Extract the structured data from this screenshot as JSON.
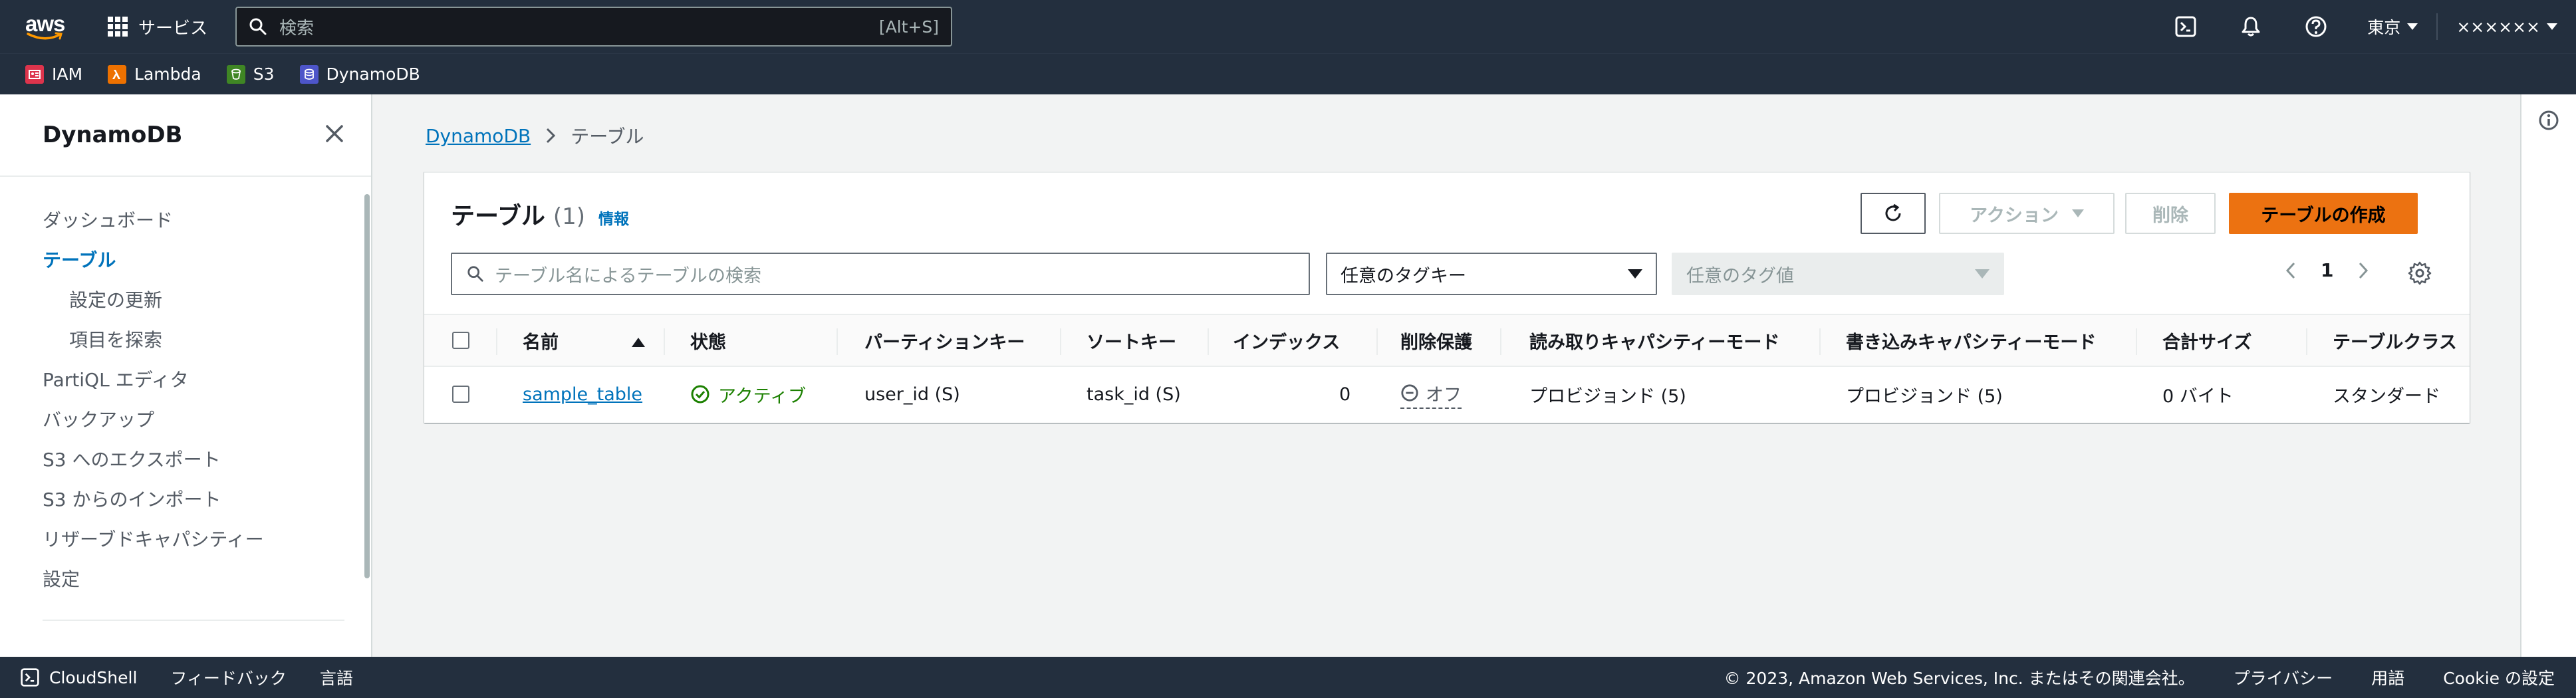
{
  "topnav": {
    "logo": "aws",
    "services_label": "サービス",
    "search_placeholder": "検索",
    "search_shortcut": "[Alt+S]",
    "region": "東京",
    "account": "××××××"
  },
  "favorites": [
    {
      "label": "IAM",
      "color": "#dd344c"
    },
    {
      "label": "Lambda",
      "color": "#ed7100"
    },
    {
      "label": "S3",
      "color": "#3f8624"
    },
    {
      "label": "DynamoDB",
      "color": "#4d55c9"
    }
  ],
  "sidenav": {
    "title": "DynamoDB",
    "items": [
      {
        "label": "ダッシュボード"
      },
      {
        "label": "テーブル"
      },
      {
        "label": "設定の更新"
      },
      {
        "label": "項目を探索"
      },
      {
        "label": "PartiQL エディタ"
      },
      {
        "label": "バックアップ"
      },
      {
        "label": "S3 へのエクスポート"
      },
      {
        "label": "S3 からのインポート"
      },
      {
        "label": "リザーブドキャパシティー"
      },
      {
        "label": "設定"
      }
    ]
  },
  "breadcrumb": {
    "root": "DynamoDB",
    "current": "テーブル"
  },
  "panel": {
    "title": "テーブル",
    "count": "(1)",
    "info": "情報",
    "actions_label": "アクション",
    "delete_label": "削除",
    "create_label": "テーブルの作成",
    "search_placeholder": "テーブル名によるテーブルの検索",
    "tag_key_placeholder": "任意のタグキー",
    "tag_value_placeholder": "任意のタグ値",
    "page": "1"
  },
  "table": {
    "columns": [
      "名前",
      "状態",
      "パーティションキー",
      "ソートキー",
      "インデックス",
      "削除保護",
      "読み取りキャパシティーモード",
      "書き込みキャパシティーモード",
      "合計サイズ",
      "テーブルクラス"
    ],
    "rows": [
      {
        "name": "sample_table",
        "status": "アクティブ",
        "partition_key": "user_id (S)",
        "sort_key": "task_id (S)",
        "indexes": "0",
        "deletion_protection": "オフ",
        "read_mode": "プロビジョンド (5)",
        "write_mode": "プロビジョンド (5)",
        "size": "0 バイト",
        "table_class": "スタンダード"
      }
    ]
  },
  "footer": {
    "cloudshell": "CloudShell",
    "feedback": "フィードバック",
    "language": "言語",
    "copyright": "© 2023, Amazon Web Services, Inc. またはその関連会社。",
    "privacy": "プライバシー",
    "terms": "用語",
    "cookie": "Cookie の設定"
  }
}
